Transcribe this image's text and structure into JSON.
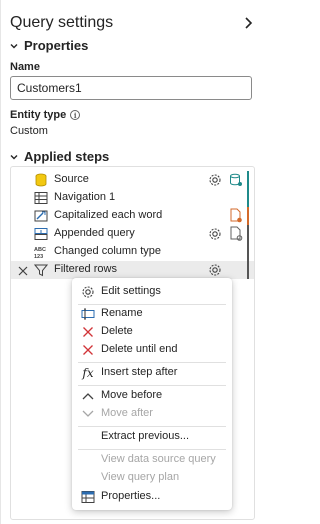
{
  "panel": {
    "title": "Query settings",
    "properties_heading": "Properties",
    "name_label": "Name",
    "name_value": "Customers1",
    "entity_type_label": "Entity type",
    "entity_type_value": "Custom",
    "applied_steps_heading": "Applied steps"
  },
  "steps": [
    {
      "label": "Source",
      "icon": "database-cylinder-icon",
      "has_gear": true,
      "diag": "diagnostic-icon",
      "bar_color": "#1f8a8a"
    },
    {
      "label": "Navigation 1",
      "icon": "table-grid-icon",
      "has_gear": false,
      "diag": "",
      "bar_color": "#1f8a8a"
    },
    {
      "label": "Capitalized each word",
      "icon": "transform-text-icon",
      "has_gear": false,
      "diag": "warning-document-icon",
      "bar_color": "#d36a2b"
    },
    {
      "label": "Appended query",
      "icon": "append-table-icon",
      "has_gear": true,
      "diag": "document-gray-icon",
      "bar_color": "#555555"
    },
    {
      "label": "Changed column type",
      "icon": "abc-123-type-icon",
      "has_gear": false,
      "diag": "",
      "bar_color": "#555555"
    },
    {
      "label": "Filtered rows",
      "icon": "filter-funnel-icon",
      "has_gear": true,
      "diag": "",
      "bar_color": "#555555",
      "selected": true
    }
  ],
  "context_menu": {
    "items": [
      {
        "label": "Edit settings",
        "icon": "gear-icon",
        "disabled": false
      },
      {
        "label": "Rename",
        "icon": "rename-icon",
        "disabled": false
      },
      {
        "label": "Delete",
        "icon": "delete-x-icon",
        "disabled": false
      },
      {
        "label": "Delete until end",
        "icon": "delete-x-icon",
        "disabled": false
      },
      {
        "label": "Insert step after",
        "icon": "fx-icon",
        "disabled": false
      },
      {
        "label": "Move before",
        "icon": "chevron-up-icon",
        "disabled": false
      },
      {
        "label": "Move after",
        "icon": "chevron-down-icon",
        "disabled": true
      },
      {
        "label": "Extract previous...",
        "icon": "",
        "disabled": false
      },
      {
        "label": "View data source query",
        "icon": "",
        "disabled": true
      },
      {
        "label": "View query plan",
        "icon": "",
        "disabled": true
      },
      {
        "label": "Properties...",
        "icon": "properties-table-icon",
        "disabled": false
      }
    ]
  },
  "colors": {
    "accent_red": "#d13438",
    "accent_teal": "#1f8a8a",
    "accent_orange": "#d36a2b",
    "icon_yellow": "#f2c811"
  }
}
